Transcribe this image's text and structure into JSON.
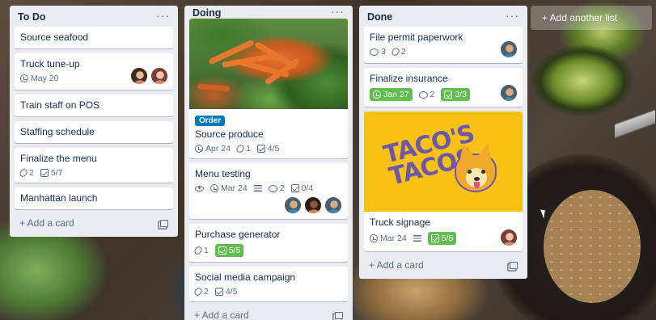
{
  "lists": [
    {
      "title": "To Do",
      "menu": "···",
      "add_card": "+ Add a card",
      "cards": [
        {
          "title": "Source seafood"
        },
        {
          "title": "Truck tune-up",
          "due": "May 20"
        },
        {
          "title": "Train staff on POS"
        },
        {
          "title": "Staffing schedule"
        },
        {
          "title": "Finalize the menu",
          "attachments": "2",
          "checklist": "5/7"
        },
        {
          "title": "Manhattan launch"
        }
      ]
    },
    {
      "title": "Doing",
      "menu": "···",
      "add_card": "+ Add a card",
      "cards": [
        {
          "title": "Source produce",
          "label": "Order",
          "due": "Apr 24",
          "attachments": "1",
          "checklist": "4/5"
        },
        {
          "title": "Menu testing",
          "due": "Mar 24",
          "comments": "2",
          "checklist": "0/4"
        },
        {
          "title": "Purchase generator",
          "attachments": "1",
          "checklist": "5/5"
        },
        {
          "title": "Social media campaign",
          "attachments": "2",
          "checklist": "4/5"
        }
      ]
    },
    {
      "title": "Done",
      "menu": "···",
      "add_card": "+ Add a card",
      "cards": [
        {
          "title": "File permit paperwork",
          "comments": "3",
          "attachments": "2"
        },
        {
          "title": "Finalize insurance",
          "due": "Jan 27",
          "comments": "2",
          "checklist": "3/3"
        },
        {
          "title": "Truck signage",
          "due": "Mar 24",
          "checklist": "5/5",
          "cover_text": "TACO'S TACOS"
        }
      ]
    }
  ],
  "add_list": "+ Add another list",
  "colors": {
    "list_bg": "#ebecf0",
    "label_blue": "#0079bf",
    "badge_green": "#61bd4f",
    "taco_yellow": "#f8c115"
  },
  "icons": {
    "due": "clock-icon",
    "attachments": "paperclip-icon",
    "comments": "comment-icon",
    "checklist": "checklist-icon",
    "description": "description-icon",
    "watch": "eye-icon",
    "template": "card-template-icon"
  }
}
